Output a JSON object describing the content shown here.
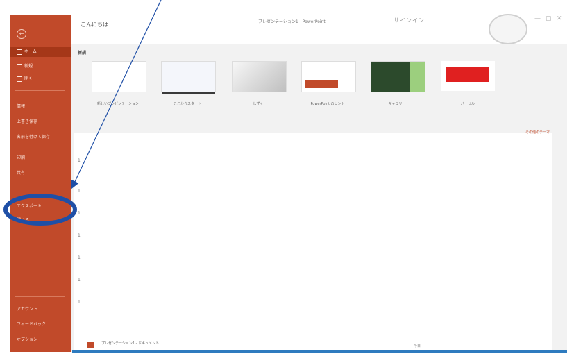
{
  "sidebar": {
    "back_icon": "back-arrow-icon",
    "items": [
      {
        "label": "ホーム",
        "active": true
      },
      {
        "label": "新規"
      },
      {
        "label": "開く"
      }
    ],
    "mid_items": [
      {
        "label": "情報"
      },
      {
        "label": "上書き保存"
      },
      {
        "label": "名前を付けて保存"
      },
      {
        "label": "印刷"
      },
      {
        "label": "共有"
      }
    ],
    "annotated_items": [
      {
        "label": "エクスポート"
      },
      {
        "label": "閉じる"
      }
    ],
    "bottom_items": [
      {
        "label": "アカウント"
      },
      {
        "label": "フィードバック"
      },
      {
        "label": "オプション"
      }
    ]
  },
  "topbar": {
    "greeting": "こんにちは",
    "doc_title": "プレゼンテーション1 - PowerPoint",
    "account": "サインイン"
  },
  "new_section": {
    "heading": "新規",
    "templates": [
      {
        "label": "新しいプレゼンテーション"
      },
      {
        "label": "ここからスタート"
      },
      {
        "label": "しずく"
      },
      {
        "label": "PowerPoint のヒント"
      },
      {
        "label": "ギャラリー"
      },
      {
        "label": "パーセル"
      }
    ],
    "template_accents": [
      "#ffffff",
      "#3a3a3a",
      "#d9d9d9",
      "#c14a2a",
      "#2c4a2c",
      "#e02020"
    ]
  },
  "recent": {
    "more_link": "その他のテーマ",
    "row_text": "プレゼンテーション1 - ドキュメント",
    "row_date": "今日"
  },
  "annotation": {
    "color": "#1f4fa6"
  }
}
